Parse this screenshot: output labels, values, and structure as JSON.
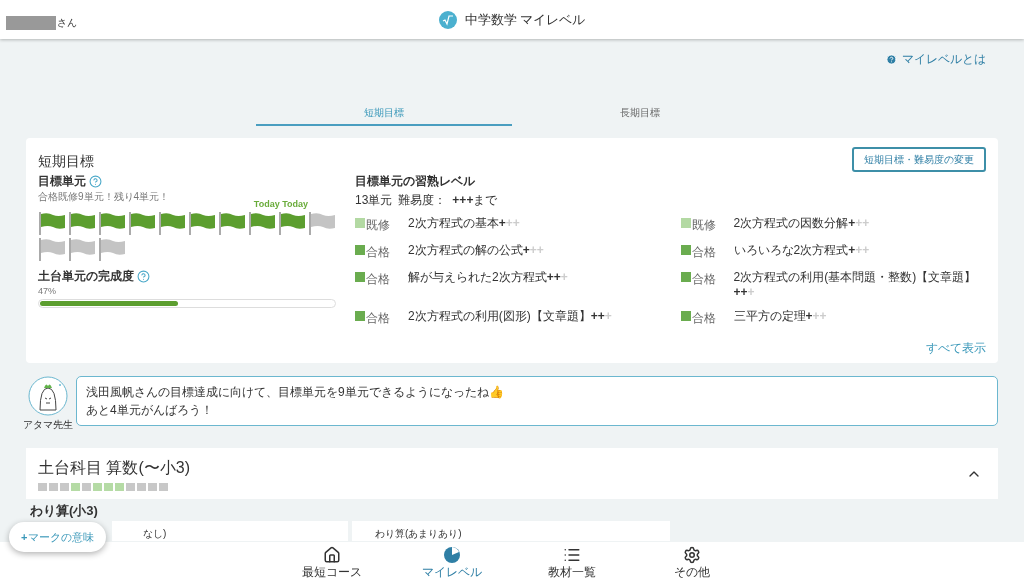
{
  "header": {
    "user_suffix": "さん",
    "title": "中学数学 マイレベル"
  },
  "help_link": "マイレベルとは",
  "tabs": [
    {
      "label": "短期目標",
      "selected": true
    },
    {
      "label": "長期目標",
      "selected": false
    }
  ],
  "goal_card": {
    "title": "短期目標",
    "change_button": "短期目標・難易度の変更",
    "target_units": {
      "heading": "目標単元",
      "note": "合格既修9単元！残り4単元！",
      "today_label": "Today Today",
      "flags": [
        {
          "achieved": true
        },
        {
          "achieved": true
        },
        {
          "achieved": true
        },
        {
          "achieved": true
        },
        {
          "achieved": true
        },
        {
          "achieved": true
        },
        {
          "achieved": true
        },
        {
          "achieved": true
        },
        {
          "achieved": true
        },
        {
          "achieved": false
        },
        {
          "achieved": false
        },
        {
          "achieved": false
        },
        {
          "achieved": false
        }
      ]
    },
    "foundation": {
      "heading": "土台単元の完成度",
      "reading": "47%",
      "level": 0.47
    },
    "mastery": {
      "heading": "目標単元の習熟レベル",
      "count": "13単元",
      "difficulty_label": "難易度：",
      "difficulty_marks": "+++",
      "difficulty_suffix": "まで",
      "units": [
        {
          "kind": "known",
          "status": "既修",
          "name": "2次方程式の基本",
          "marks_filled": "+",
          "marks_empty": "++"
        },
        {
          "kind": "known",
          "status": "既修",
          "name": "2次方程式の因数分解",
          "marks_filled": "+",
          "marks_empty": "++"
        },
        {
          "kind": "passed",
          "status": "合格",
          "name": "2次方程式の解の公式",
          "marks_filled": "+",
          "marks_empty": "++"
        },
        {
          "kind": "passed",
          "status": "合格",
          "name": "いろいろな2次方程式",
          "marks_filled": "+",
          "marks_empty": "++"
        },
        {
          "kind": "passed",
          "status": "合格",
          "name": "解が与えられた2次方程式",
          "marks_filled": "++",
          "marks_empty": "+"
        },
        {
          "kind": "passed",
          "status": "合格",
          "name": "2次方程式の利用(基本問題・整数)【文章題】",
          "marks_filled": "++",
          "marks_empty": "+"
        },
        {
          "kind": "passed",
          "status": "合格",
          "name": "2次方程式の利用(図形)【文章題】",
          "marks_filled": "++",
          "marks_empty": "+"
        },
        {
          "kind": "passed",
          "status": "合格",
          "name": "三平方の定理",
          "marks_filled": "+",
          "marks_empty": "++"
        }
      ],
      "show_all": "すべて表示"
    }
  },
  "message": {
    "teacher": "アタマ先生",
    "lines": [
      "浅田風帆さんの目標達成に向けて、目標単元を9単元できるようになったね👍",
      "あと4単元がんばろう！"
    ]
  },
  "foundation_subject": {
    "title": "土台科目 算数(〜小3)",
    "expanded": true,
    "squares": [
      {
        "color": "#c8c8c8"
      },
      {
        "color": "#c8c8c8"
      },
      {
        "color": "#c8c8c8"
      },
      {
        "color": "#b5dba5"
      },
      {
        "color": "#c8c8c8"
      },
      {
        "color": "#b5dba5"
      },
      {
        "color": "#b5dba5"
      },
      {
        "color": "#b5dba5"
      },
      {
        "color": "#c8c8c8"
      },
      {
        "color": "#c8c8c8"
      },
      {
        "color": "#c8c8c8"
      },
      {
        "color": "#c8c8c8"
      }
    ],
    "group": "わり算(小3)",
    "cards": [
      "なし)",
      "わり算(あまりあり)"
    ]
  },
  "legend_button": {
    "icon": "+",
    "label": "マークの意味"
  },
  "bottom_nav": [
    {
      "label": "最短コース",
      "selected": false
    },
    {
      "label": "マイレベル",
      "selected": true
    },
    {
      "label": "教材一覧",
      "selected": false
    },
    {
      "label": "その他",
      "selected": false
    }
  ]
}
